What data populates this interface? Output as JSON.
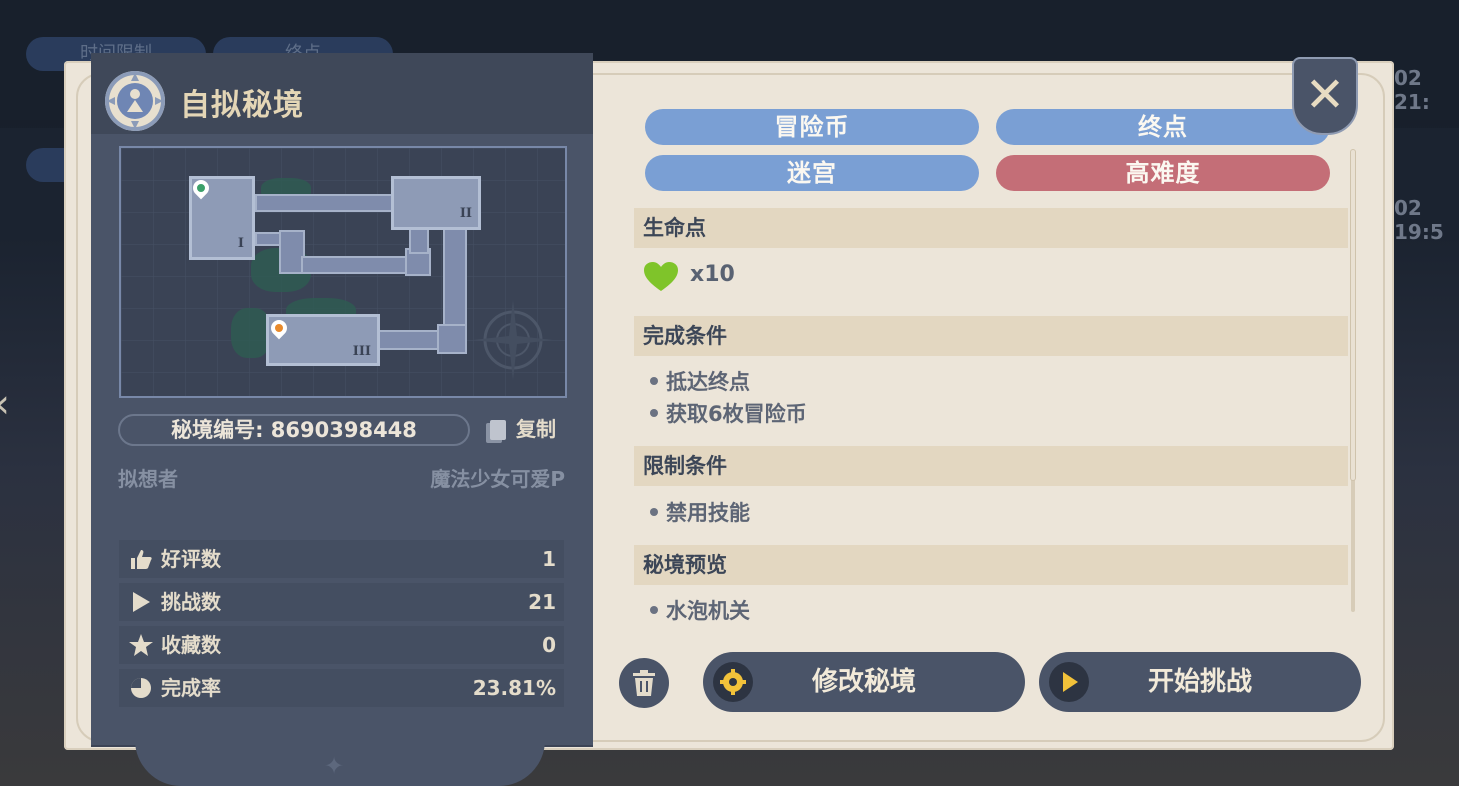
{
  "background": {
    "pills": [
      "时间限制",
      "终点"
    ],
    "dates": [
      "02 21:",
      "02 19:5"
    ]
  },
  "panel": {
    "title": "自拟秘境",
    "map": {
      "rooms": [
        "I",
        "II",
        "III"
      ]
    },
    "code_label": "秘境编号: 8690398448",
    "copy_label": "复制",
    "author_label": "拟想者",
    "author_name": "魔法少女可爱P",
    "stats": [
      {
        "icon": "thumbs-up-icon",
        "label": "好评数",
        "value": "1"
      },
      {
        "icon": "play-icon",
        "label": "挑战数",
        "value": "21"
      },
      {
        "icon": "star-icon",
        "label": "收藏数",
        "value": "0"
      },
      {
        "icon": "pie-icon",
        "label": "完成率",
        "value": "23.81%"
      }
    ]
  },
  "tags": [
    {
      "label": "冒险币",
      "color": "#7a9fd4"
    },
    {
      "label": "终点",
      "color": "#7a9fd4"
    },
    {
      "label": "迷宫",
      "color": "#7a9fd4"
    },
    {
      "label": "高难度",
      "color": "#c46e77"
    }
  ],
  "sections": {
    "life": {
      "title": "生命点",
      "value": "x10",
      "icon": "heart-icon",
      "icon_color": "#7fc42a"
    },
    "completion": {
      "title": "完成条件",
      "items": [
        "抵达终点",
        "获取6枚冒险币"
      ]
    },
    "restriction": {
      "title": "限制条件",
      "items": [
        "禁用技能"
      ]
    },
    "preview": {
      "title": "秘境预览",
      "items": [
        "水泡机关"
      ]
    }
  },
  "actions": {
    "edit_label": "修改秘境",
    "start_label": "开始挑战",
    "edit_icon_color": "#f2c23a",
    "start_icon_color": "#f2c23a"
  }
}
